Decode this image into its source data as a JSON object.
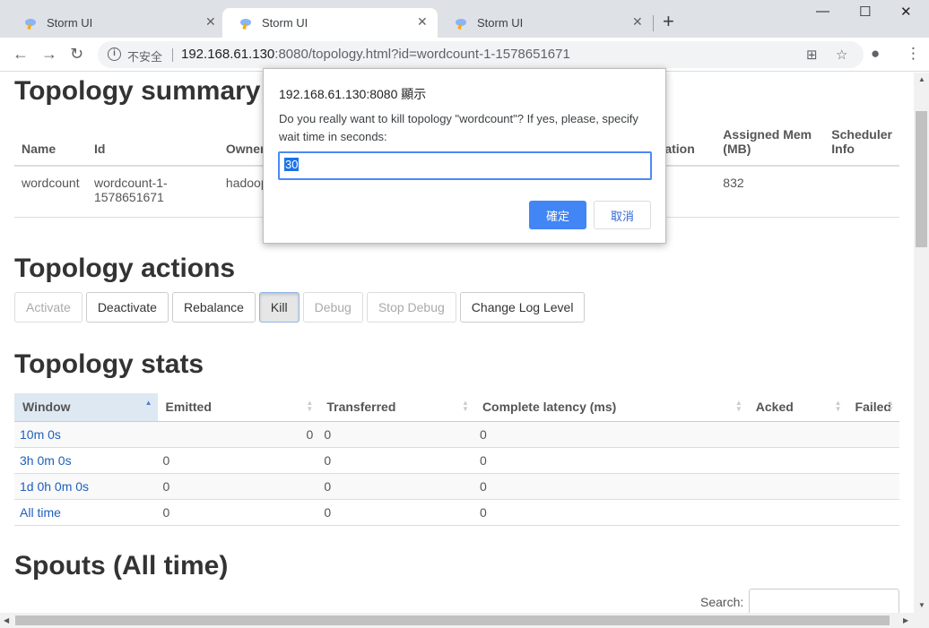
{
  "browser": {
    "tabs": [
      {
        "title": "Storm UI",
        "active": false
      },
      {
        "title": "Storm UI",
        "active": true
      },
      {
        "title": "Storm UI",
        "active": false
      }
    ],
    "new_tab": "+",
    "window_controls": {
      "minimize": "—",
      "maximize": "☐",
      "close": "✕"
    },
    "omnibox": {
      "security_label": "不安全",
      "url_host": "192.168.61.130",
      "url_rest": ":8080/topology.html?id=wordcount-1-1578651671"
    }
  },
  "summary": {
    "heading": "Topology summary",
    "columns": [
      "Name",
      "Id",
      "Owner",
      "",
      "ation",
      "Assigned Mem (MB)",
      "Scheduler Info"
    ],
    "row": {
      "name": "wordcount",
      "id": "wordcount-1-1578651671",
      "owner": "hadoop",
      "assigned_mem": "832"
    }
  },
  "actions": {
    "heading": "Topology actions",
    "buttons": [
      {
        "label": "Activate",
        "state": "disabled"
      },
      {
        "label": "Deactivate",
        "state": "enabled"
      },
      {
        "label": "Rebalance",
        "state": "enabled"
      },
      {
        "label": "Kill",
        "state": "pressed"
      },
      {
        "label": "Debug",
        "state": "disabled"
      },
      {
        "label": "Stop Debug",
        "state": "disabled"
      },
      {
        "label": "Change Log Level",
        "state": "enabled"
      }
    ]
  },
  "stats": {
    "heading": "Topology stats",
    "columns": [
      "Window",
      "Emitted",
      "Transferred",
      "Complete latency (ms)",
      "Acked",
      "Failed"
    ],
    "rows": [
      {
        "window": "10m 0s",
        "emitted": "0",
        "transferred": "0",
        "latency": "0",
        "acked": "",
        "failed": ""
      },
      {
        "window": "3h 0m 0s",
        "emitted": "0",
        "transferred": "0",
        "latency": "0",
        "acked": "",
        "failed": ""
      },
      {
        "window": "1d 0h 0m 0s",
        "emitted": "0",
        "transferred": "0",
        "latency": "0",
        "acked": "",
        "failed": ""
      },
      {
        "window": "All time",
        "emitted": "0",
        "transferred": "0",
        "latency": "0",
        "acked": "",
        "failed": ""
      }
    ]
  },
  "spouts": {
    "heading": "Spouts (All time)",
    "search_label": "Search:",
    "search_value": ""
  },
  "dialog": {
    "title": "192.168.61.130:8080 顯示",
    "message": "Do you really want to kill topology \"wordcount\"? If yes, please, specify wait time in seconds:",
    "input_value": "30",
    "ok_label": "確定",
    "cancel_label": "取消"
  }
}
